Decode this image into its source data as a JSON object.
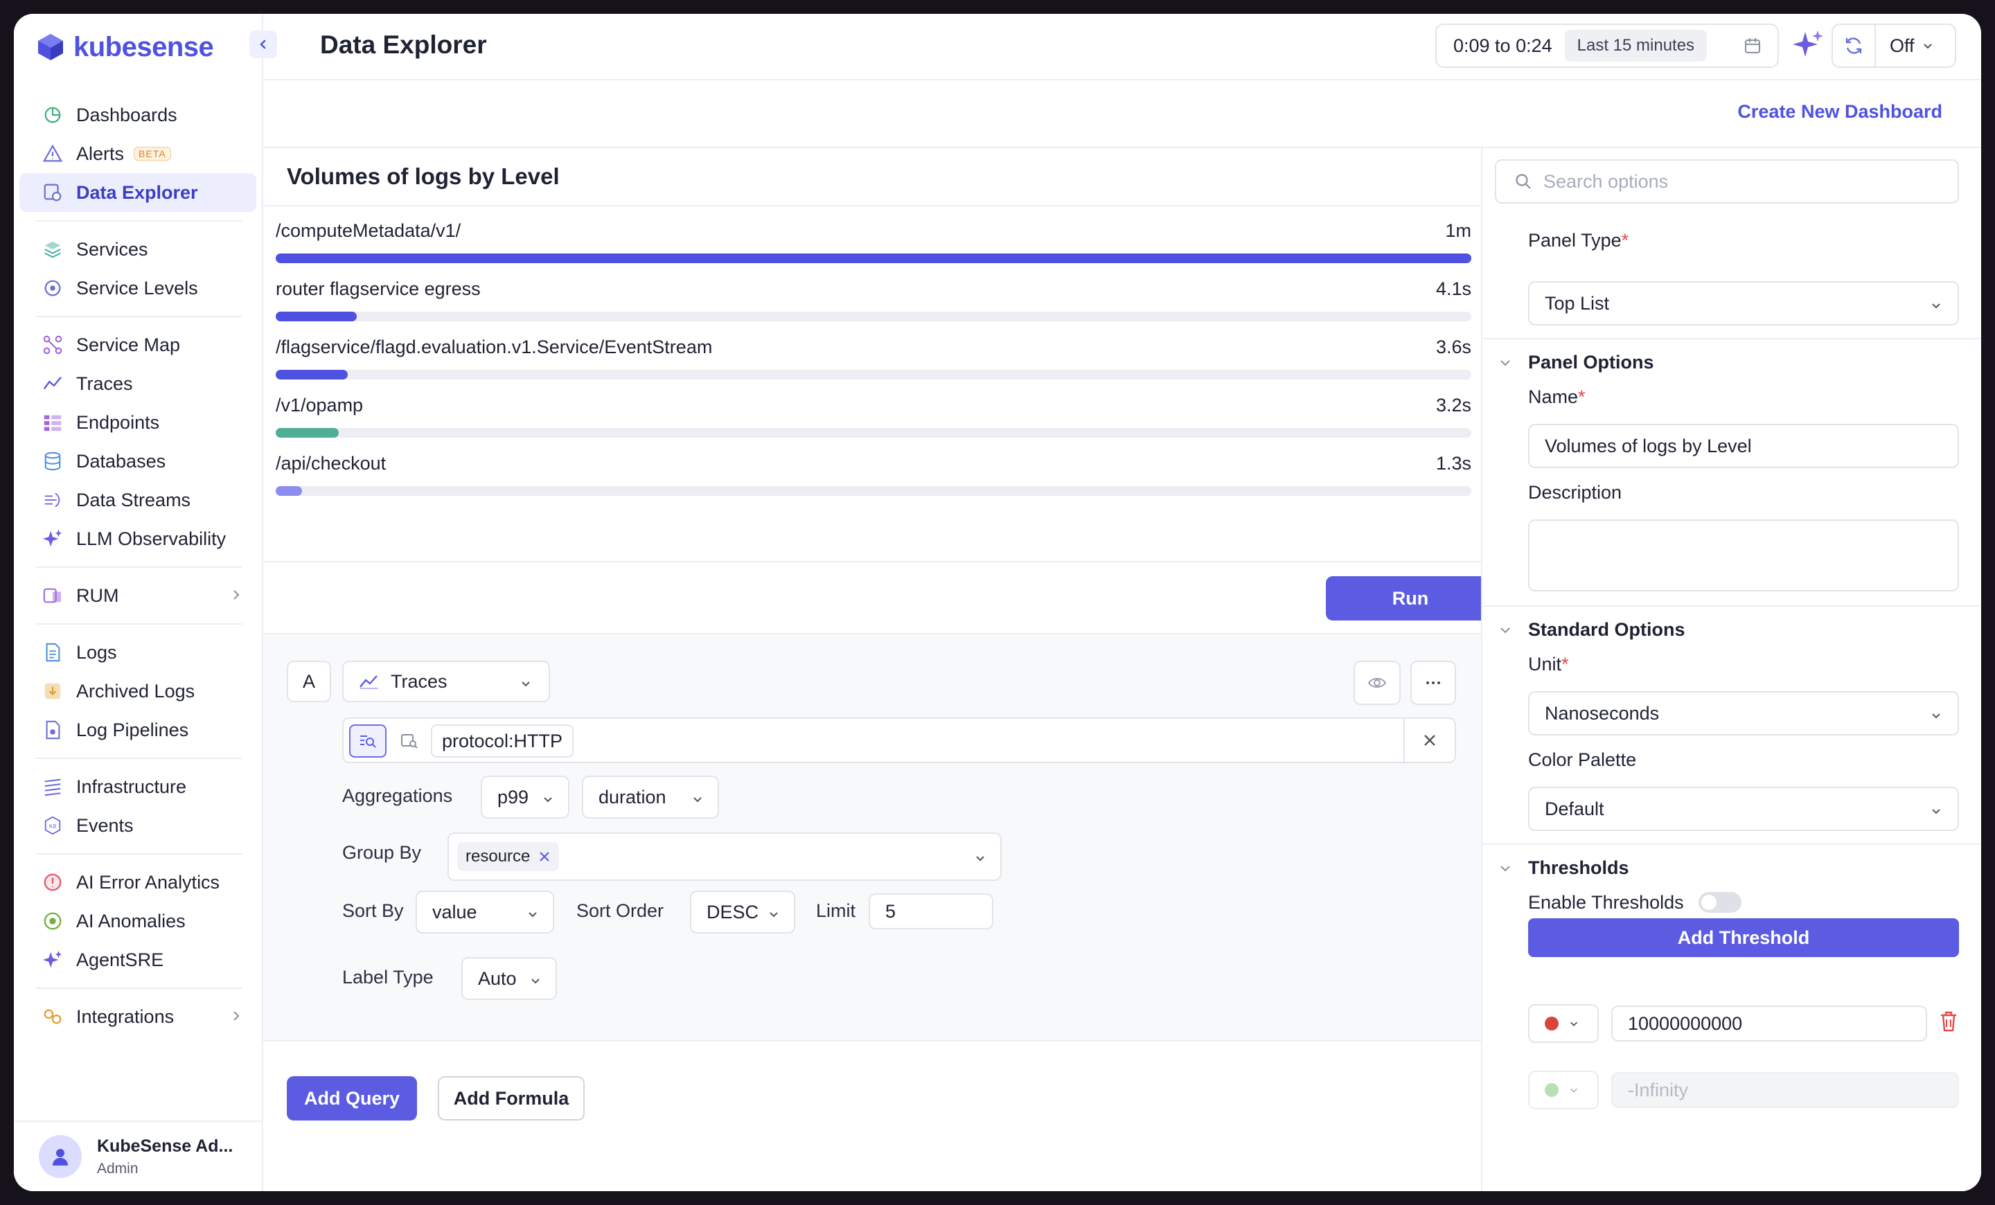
{
  "app": {
    "brand": "kubesense",
    "brand_color": "#4f52e0",
    "accent": "#5b5ce2"
  },
  "sidebar": {
    "groups": [
      [
        {
          "label": "Dashboards",
          "icon": "dashboard-icon",
          "color": "#3fb07a"
        },
        {
          "label": "Alerts",
          "icon": "alert-triangle-icon",
          "badge": "BETA",
          "color": "#6b6fd6"
        },
        {
          "label": "Data Explorer",
          "icon": "data-explorer-icon",
          "active": true,
          "color": "#6b6fd6"
        }
      ],
      [
        {
          "label": "Services",
          "icon": "services-icon",
          "color": "#3fb0a0"
        },
        {
          "label": "Service Levels",
          "icon": "service-levels-icon",
          "color": "#6b6fd6"
        }
      ],
      [
        {
          "label": "Service Map",
          "icon": "service-map-icon",
          "color": "#a065e0"
        },
        {
          "label": "Traces",
          "icon": "traces-icon",
          "color": "#5b5ce2"
        },
        {
          "label": "Endpoints",
          "icon": "endpoints-icon",
          "color": "#a065e0"
        },
        {
          "label": "Databases",
          "icon": "database-icon",
          "color": "#4f8fe0"
        },
        {
          "label": "Data Streams",
          "icon": "data-streams-icon",
          "color": "#7a6fe0"
        },
        {
          "label": "LLM Observability",
          "icon": "sparkle-icon",
          "color": "#6b5ce2"
        }
      ],
      [
        {
          "label": "RUM",
          "icon": "rum-icon",
          "chevron": true,
          "color": "#a065e0"
        }
      ],
      [
        {
          "label": "Logs",
          "icon": "logs-icon",
          "color": "#4f8fe0"
        },
        {
          "label": "Archived Logs",
          "icon": "archived-logs-icon",
          "color": "#e0a030"
        },
        {
          "label": "Log Pipelines",
          "icon": "log-pipelines-icon",
          "color": "#6b6fd6"
        }
      ],
      [
        {
          "label": "Infrastructure",
          "icon": "infrastructure-icon",
          "color": "#6b6fd6"
        },
        {
          "label": "Events",
          "icon": "events-icon",
          "color": "#6b6fd6"
        }
      ],
      [
        {
          "label": "AI Error Analytics",
          "icon": "ai-error-icon",
          "color": "#e05a6a"
        },
        {
          "label": "AI Anomalies",
          "icon": "ai-anomalies-icon",
          "color": "#6fb040"
        },
        {
          "label": "AgentSRE",
          "icon": "sparkle-icon",
          "color": "#6b5ce2"
        }
      ],
      [
        {
          "label": "Integrations",
          "icon": "integrations-icon",
          "chevron": true,
          "color": "#e0a030"
        }
      ]
    ],
    "user": {
      "name": "KubeSense Ad...",
      "role": "Admin"
    }
  },
  "header": {
    "title": "Data Explorer",
    "time_range": "0:09 to 0:24",
    "time_label": "Last 15 minutes",
    "refresh": "Off",
    "create_dashboard": "Create New Dashboard"
  },
  "panel": {
    "title": "Volumes of logs by Level",
    "rows": [
      {
        "label": "/computeMetadata/v1/",
        "value": "1m",
        "fraction": 1.0,
        "color": "#4f52e0"
      },
      {
        "label": "router flagservice egress",
        "value": "4.1s",
        "fraction": 0.068,
        "color": "#4f52e0"
      },
      {
        "label": "/flagservice/flagd.evaluation.v1.Service/EventStream",
        "value": "3.6s",
        "fraction": 0.06,
        "color": "#4f52e0"
      },
      {
        "label": "/v1/opamp",
        "value": "3.2s",
        "fraction": 0.053,
        "color": "#4fae96"
      },
      {
        "label": "/api/checkout",
        "value": "1.3s",
        "fraction": 0.022,
        "color": "#8b8ef0"
      }
    ],
    "run": "Run"
  },
  "query": {
    "letter": "A",
    "source": "Traces",
    "filter_chip": "protocol:HTTP",
    "aggregations_label": "Aggregations",
    "agg_fn": "p99",
    "agg_field": "duration",
    "group_by_label": "Group By",
    "group_by_chip": "resource",
    "sort_by_label": "Sort By",
    "sort_by": "value",
    "sort_order_label": "Sort Order",
    "sort_order": "DESC",
    "limit_label": "Limit",
    "limit": "5",
    "label_type_label": "Label Type",
    "label_type": "Auto",
    "add_query": "Add Query",
    "add_formula": "Add Formula"
  },
  "options": {
    "search_placeholder": "Search options",
    "panel_type_label": "Panel Type",
    "panel_type": "Top List",
    "panel_options": "Panel Options",
    "name_label": "Name",
    "name_value": "Volumes of logs by Level",
    "description_label": "Description",
    "standard_options": "Standard Options",
    "unit_label": "Unit",
    "unit": "Nanoseconds",
    "palette_label": "Color Palette",
    "palette": "Default",
    "thresholds": "Thresholds",
    "enable_thresholds": "Enable Thresholds",
    "add_threshold": "Add Threshold",
    "threshold_1": {
      "value": "10000000000",
      "color": "#d9453c"
    },
    "threshold_2": {
      "placeholder": "-Infinity",
      "color": "#9cd29a"
    }
  }
}
